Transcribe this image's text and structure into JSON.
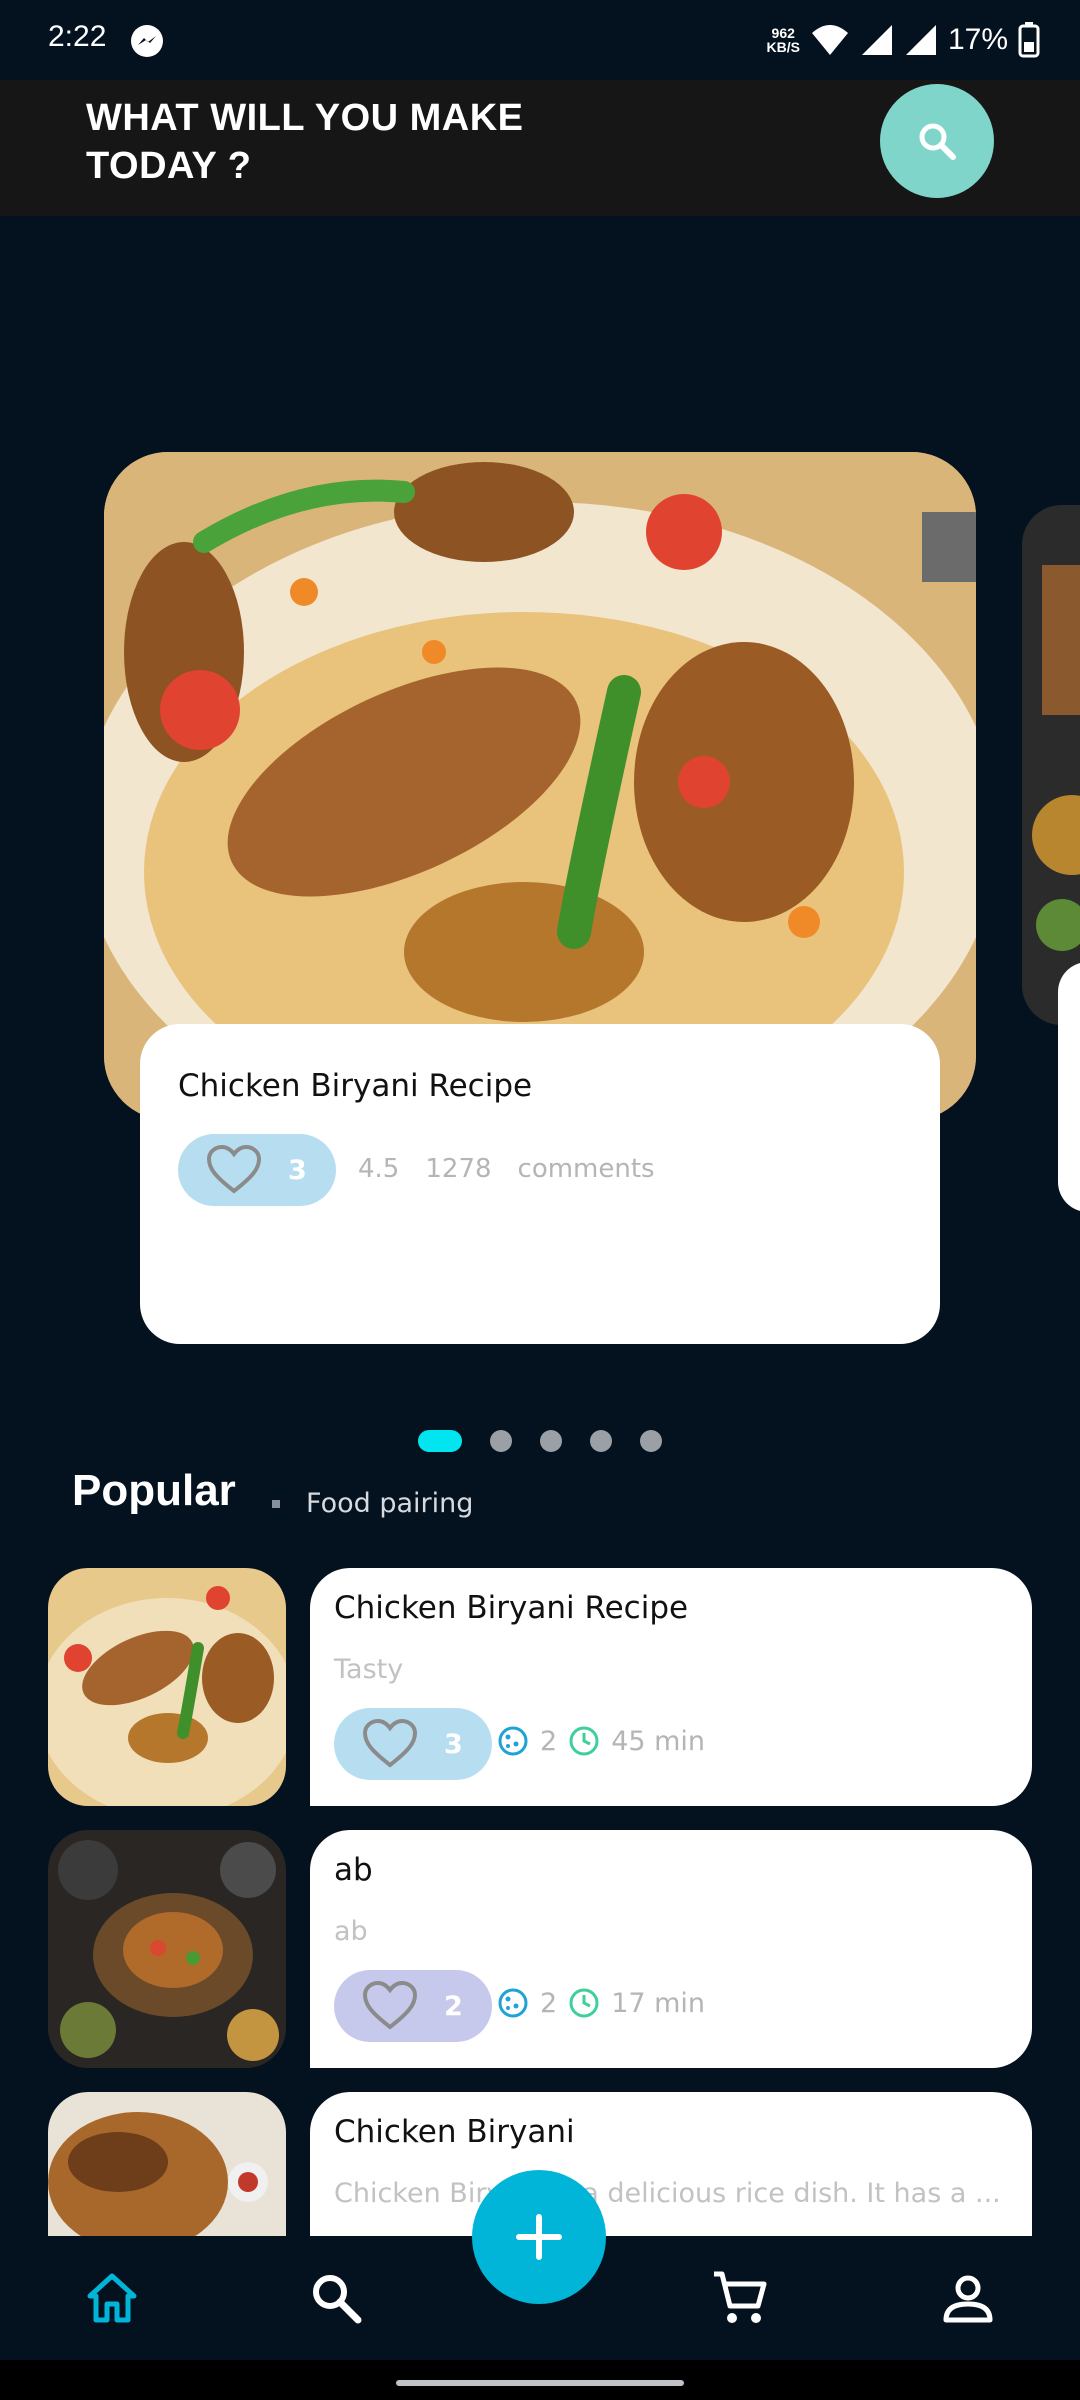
{
  "status_bar": {
    "time": "2:22",
    "net_speed_value": "962",
    "net_speed_unit": "KB/S",
    "battery": "17%"
  },
  "header": {
    "title": "WHAT WILL YOU MAKE\n TODAY ?"
  },
  "featured": {
    "title": "Chicken Biryani Recipe",
    "likes": "3",
    "rating": "4.5",
    "comment_count": "1278",
    "comment_label": "comments",
    "page_count": 5,
    "active_page": 1
  },
  "popular": {
    "title": "Popular",
    "subtitle": "Food pairing",
    "items": [
      {
        "title": "Chicken Biryani Recipe",
        "subtitle": "Tasty",
        "likes": "3",
        "servings": "2",
        "time": "45 min",
        "like_color": "#b7def0"
      },
      {
        "title": "ab",
        "subtitle": "ab",
        "likes": "2",
        "servings": "2",
        "time": "17 min",
        "like_color": "#c7c9ec"
      },
      {
        "title": "Chicken Biryani",
        "subtitle": "Chicken Biryani is a delicious rice dish. It has a ..."
      }
    ]
  },
  "colors": {
    "background": "#04121f",
    "accent": "#00b5d8",
    "search_button": "#7fd5c9",
    "active_dot": "#00e5ef"
  }
}
